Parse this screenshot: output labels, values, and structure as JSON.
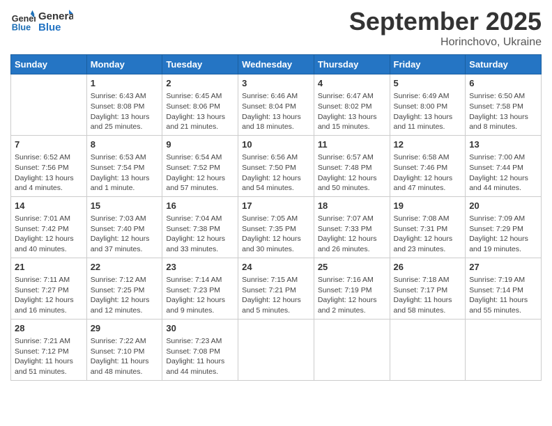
{
  "header": {
    "logo_line1": "General",
    "logo_line2": "Blue",
    "month": "September 2025",
    "location": "Horinchovo, Ukraine"
  },
  "days_of_week": [
    "Sunday",
    "Monday",
    "Tuesday",
    "Wednesday",
    "Thursday",
    "Friday",
    "Saturday"
  ],
  "weeks": [
    [
      {
        "day": "",
        "sunrise": "",
        "sunset": "",
        "daylight": ""
      },
      {
        "day": "1",
        "sunrise": "Sunrise: 6:43 AM",
        "sunset": "Sunset: 8:08 PM",
        "daylight": "Daylight: 13 hours and 25 minutes."
      },
      {
        "day": "2",
        "sunrise": "Sunrise: 6:45 AM",
        "sunset": "Sunset: 8:06 PM",
        "daylight": "Daylight: 13 hours and 21 minutes."
      },
      {
        "day": "3",
        "sunrise": "Sunrise: 6:46 AM",
        "sunset": "Sunset: 8:04 PM",
        "daylight": "Daylight: 13 hours and 18 minutes."
      },
      {
        "day": "4",
        "sunrise": "Sunrise: 6:47 AM",
        "sunset": "Sunset: 8:02 PM",
        "daylight": "Daylight: 13 hours and 15 minutes."
      },
      {
        "day": "5",
        "sunrise": "Sunrise: 6:49 AM",
        "sunset": "Sunset: 8:00 PM",
        "daylight": "Daylight: 13 hours and 11 minutes."
      },
      {
        "day": "6",
        "sunrise": "Sunrise: 6:50 AM",
        "sunset": "Sunset: 7:58 PM",
        "daylight": "Daylight: 13 hours and 8 minutes."
      }
    ],
    [
      {
        "day": "7",
        "sunrise": "Sunrise: 6:52 AM",
        "sunset": "Sunset: 7:56 PM",
        "daylight": "Daylight: 13 hours and 4 minutes."
      },
      {
        "day": "8",
        "sunrise": "Sunrise: 6:53 AM",
        "sunset": "Sunset: 7:54 PM",
        "daylight": "Daylight: 13 hours and 1 minute."
      },
      {
        "day": "9",
        "sunrise": "Sunrise: 6:54 AM",
        "sunset": "Sunset: 7:52 PM",
        "daylight": "Daylight: 12 hours and 57 minutes."
      },
      {
        "day": "10",
        "sunrise": "Sunrise: 6:56 AM",
        "sunset": "Sunset: 7:50 PM",
        "daylight": "Daylight: 12 hours and 54 minutes."
      },
      {
        "day": "11",
        "sunrise": "Sunrise: 6:57 AM",
        "sunset": "Sunset: 7:48 PM",
        "daylight": "Daylight: 12 hours and 50 minutes."
      },
      {
        "day": "12",
        "sunrise": "Sunrise: 6:58 AM",
        "sunset": "Sunset: 7:46 PM",
        "daylight": "Daylight: 12 hours and 47 minutes."
      },
      {
        "day": "13",
        "sunrise": "Sunrise: 7:00 AM",
        "sunset": "Sunset: 7:44 PM",
        "daylight": "Daylight: 12 hours and 44 minutes."
      }
    ],
    [
      {
        "day": "14",
        "sunrise": "Sunrise: 7:01 AM",
        "sunset": "Sunset: 7:42 PM",
        "daylight": "Daylight: 12 hours and 40 minutes."
      },
      {
        "day": "15",
        "sunrise": "Sunrise: 7:03 AM",
        "sunset": "Sunset: 7:40 PM",
        "daylight": "Daylight: 12 hours and 37 minutes."
      },
      {
        "day": "16",
        "sunrise": "Sunrise: 7:04 AM",
        "sunset": "Sunset: 7:38 PM",
        "daylight": "Daylight: 12 hours and 33 minutes."
      },
      {
        "day": "17",
        "sunrise": "Sunrise: 7:05 AM",
        "sunset": "Sunset: 7:35 PM",
        "daylight": "Daylight: 12 hours and 30 minutes."
      },
      {
        "day": "18",
        "sunrise": "Sunrise: 7:07 AM",
        "sunset": "Sunset: 7:33 PM",
        "daylight": "Daylight: 12 hours and 26 minutes."
      },
      {
        "day": "19",
        "sunrise": "Sunrise: 7:08 AM",
        "sunset": "Sunset: 7:31 PM",
        "daylight": "Daylight: 12 hours and 23 minutes."
      },
      {
        "day": "20",
        "sunrise": "Sunrise: 7:09 AM",
        "sunset": "Sunset: 7:29 PM",
        "daylight": "Daylight: 12 hours and 19 minutes."
      }
    ],
    [
      {
        "day": "21",
        "sunrise": "Sunrise: 7:11 AM",
        "sunset": "Sunset: 7:27 PM",
        "daylight": "Daylight: 12 hours and 16 minutes."
      },
      {
        "day": "22",
        "sunrise": "Sunrise: 7:12 AM",
        "sunset": "Sunset: 7:25 PM",
        "daylight": "Daylight: 12 hours and 12 minutes."
      },
      {
        "day": "23",
        "sunrise": "Sunrise: 7:14 AM",
        "sunset": "Sunset: 7:23 PM",
        "daylight": "Daylight: 12 hours and 9 minutes."
      },
      {
        "day": "24",
        "sunrise": "Sunrise: 7:15 AM",
        "sunset": "Sunset: 7:21 PM",
        "daylight": "Daylight: 12 hours and 5 minutes."
      },
      {
        "day": "25",
        "sunrise": "Sunrise: 7:16 AM",
        "sunset": "Sunset: 7:19 PM",
        "daylight": "Daylight: 12 hours and 2 minutes."
      },
      {
        "day": "26",
        "sunrise": "Sunrise: 7:18 AM",
        "sunset": "Sunset: 7:17 PM",
        "daylight": "Daylight: 11 hours and 58 minutes."
      },
      {
        "day": "27",
        "sunrise": "Sunrise: 7:19 AM",
        "sunset": "Sunset: 7:14 PM",
        "daylight": "Daylight: 11 hours and 55 minutes."
      }
    ],
    [
      {
        "day": "28",
        "sunrise": "Sunrise: 7:21 AM",
        "sunset": "Sunset: 7:12 PM",
        "daylight": "Daylight: 11 hours and 51 minutes."
      },
      {
        "day": "29",
        "sunrise": "Sunrise: 7:22 AM",
        "sunset": "Sunset: 7:10 PM",
        "daylight": "Daylight: 11 hours and 48 minutes."
      },
      {
        "day": "30",
        "sunrise": "Sunrise: 7:23 AM",
        "sunset": "Sunset: 7:08 PM",
        "daylight": "Daylight: 11 hours and 44 minutes."
      },
      {
        "day": "",
        "sunrise": "",
        "sunset": "",
        "daylight": ""
      },
      {
        "day": "",
        "sunrise": "",
        "sunset": "",
        "daylight": ""
      },
      {
        "day": "",
        "sunrise": "",
        "sunset": "",
        "daylight": ""
      },
      {
        "day": "",
        "sunrise": "",
        "sunset": "",
        "daylight": ""
      }
    ]
  ]
}
